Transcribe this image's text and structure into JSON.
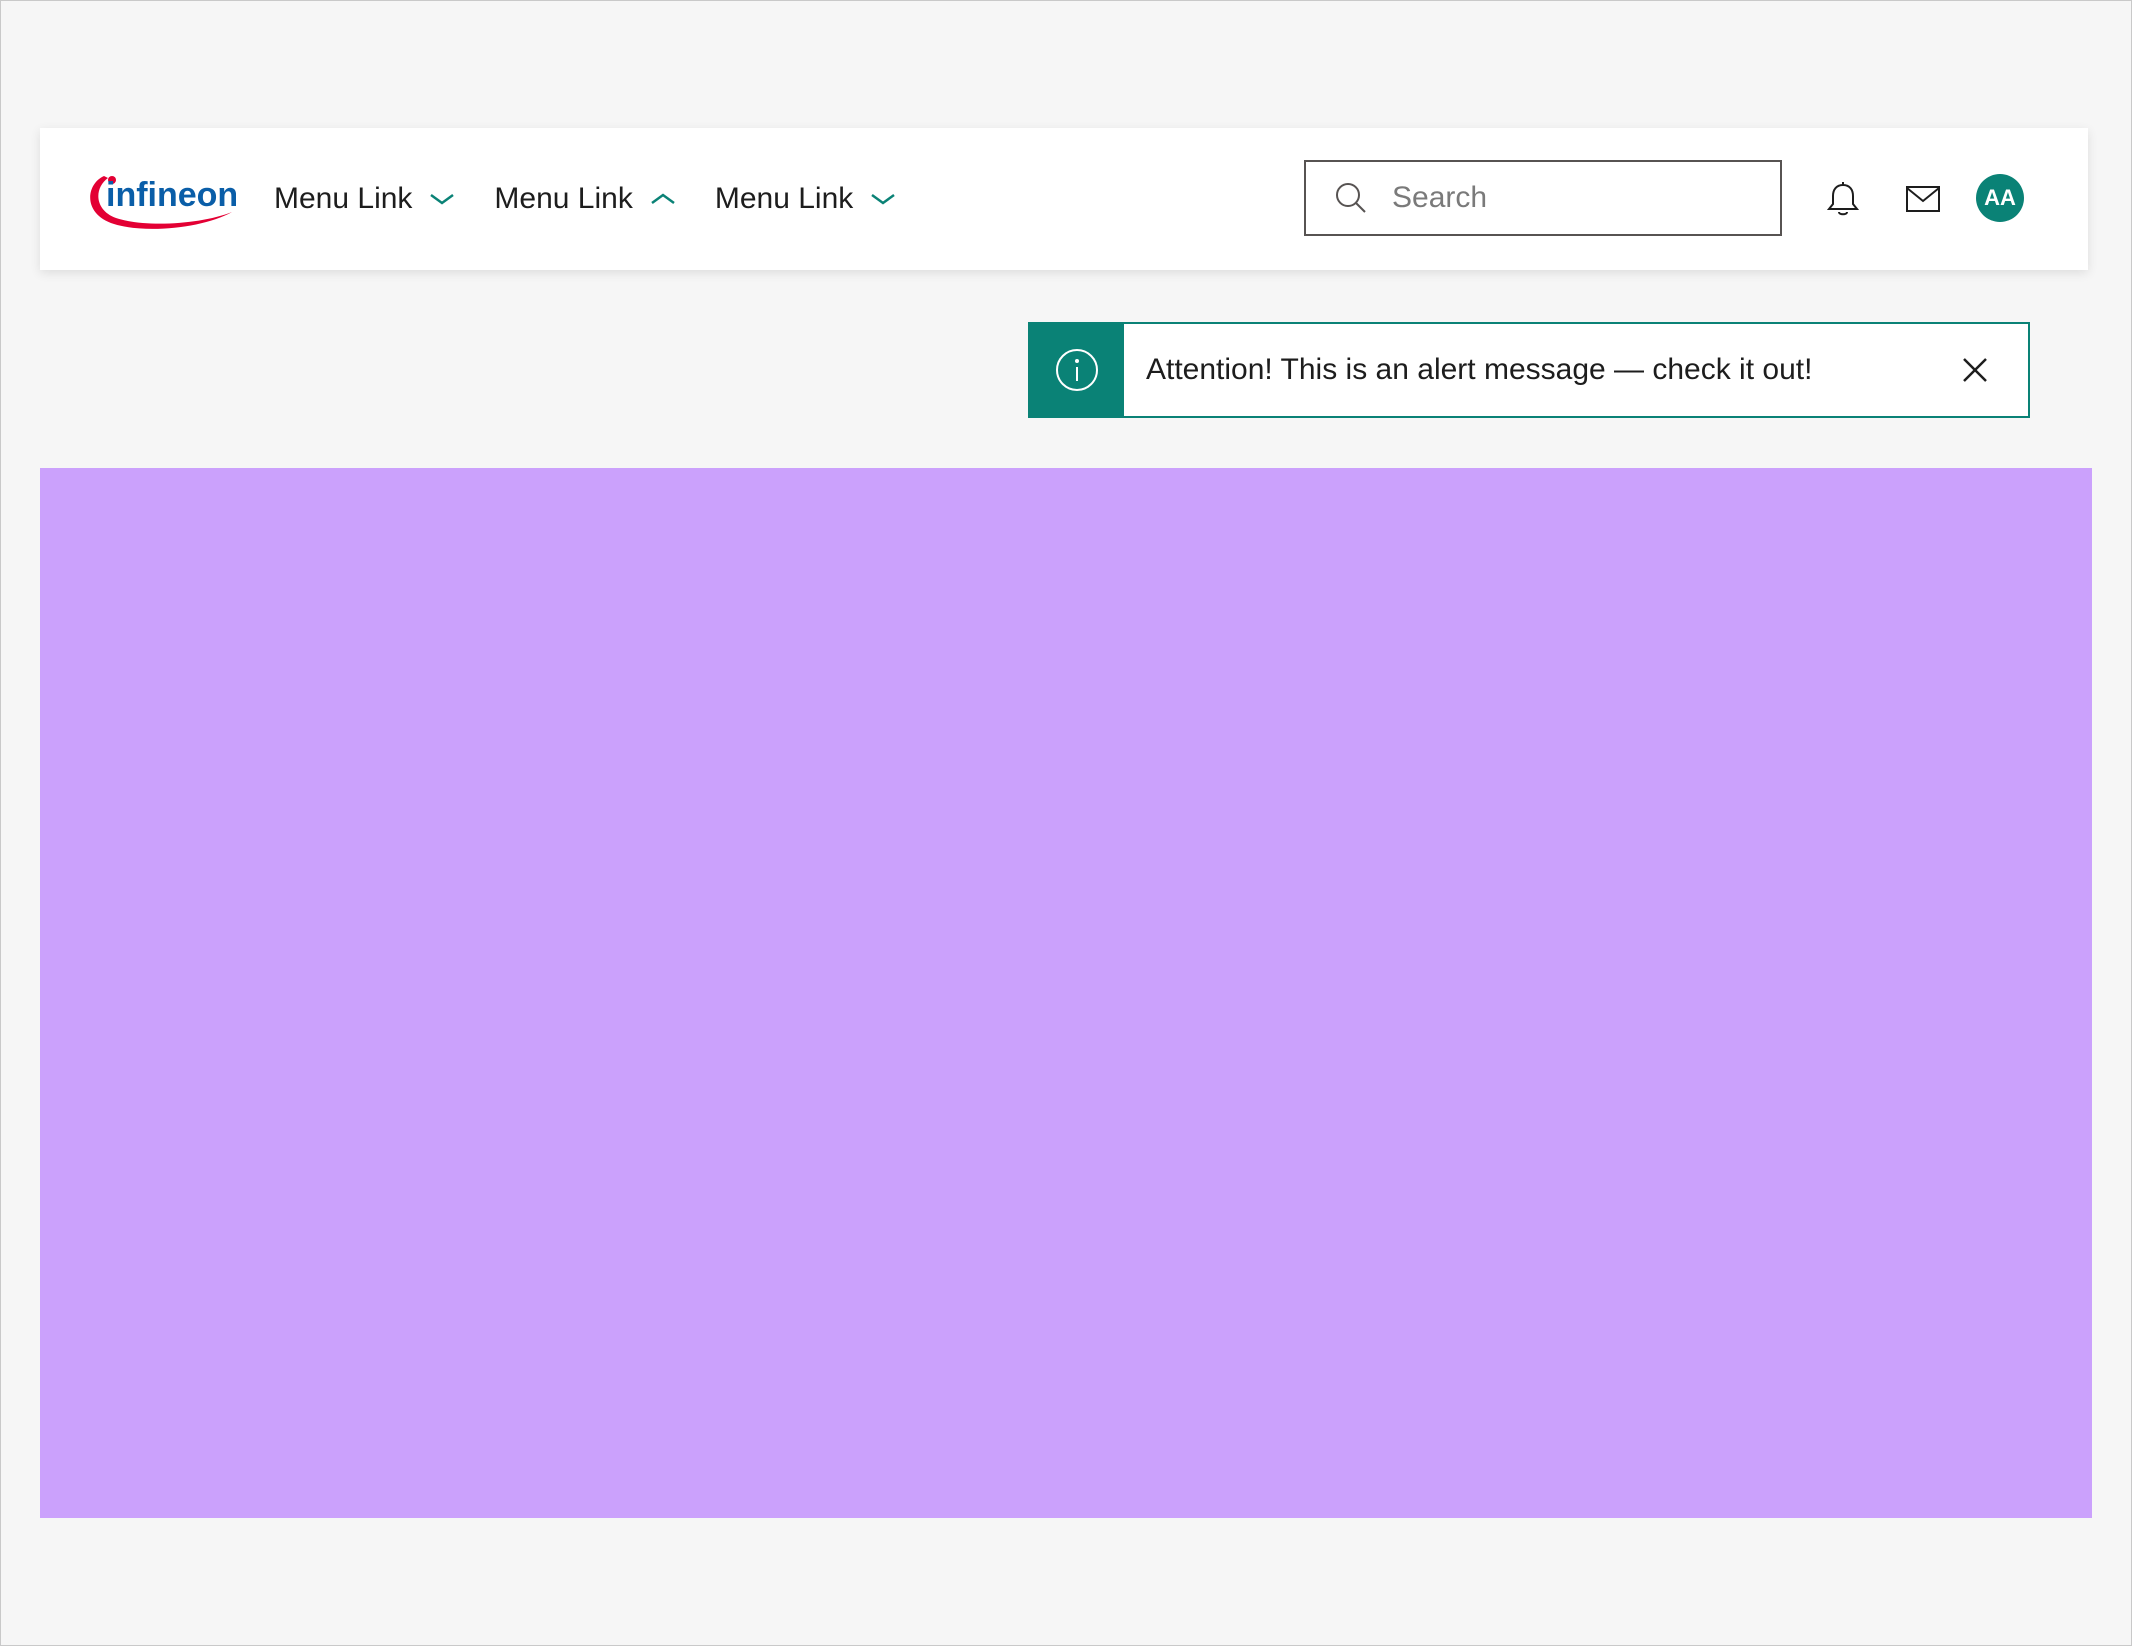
{
  "brand": {
    "logo_text": "infineon",
    "logo_color": "#0a5ea8",
    "swoosh_color": "#e30034"
  },
  "nav": {
    "items": [
      {
        "label": "Menu Link",
        "chevron": "chevron-down-icon"
      },
      {
        "label": "Menu Link",
        "chevron": "chevron-up-icon"
      },
      {
        "label": "Menu Link",
        "chevron": "chevron-down-icon"
      }
    ]
  },
  "search": {
    "placeholder": "Search",
    "value": ""
  },
  "user": {
    "initials": "AA"
  },
  "alert": {
    "message": "Attention! This is an alert message — check it out!"
  },
  "colors": {
    "accent": "#0a8276",
    "content_placeholder": "#cba1fc",
    "page_background": "#f6f6f6"
  }
}
